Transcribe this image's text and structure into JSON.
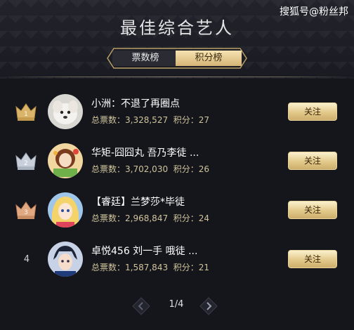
{
  "header": {
    "title": "最佳综合艺人",
    "watermark": "搜狐号@粉丝邦"
  },
  "tabs": [
    {
      "label": "票数榜",
      "active": false
    },
    {
      "label": "积分榜",
      "active": true
    }
  ],
  "colors": {
    "background": "#15161c",
    "gold": "#d8bd7e",
    "stats_text": "#d0c49c",
    "silver": "#b8c0cc",
    "bronze": "#d9a27a"
  },
  "list": [
    {
      "rank": "1",
      "rank_icon": "gold-crown-icon",
      "name": "小洲：不退了再圈点",
      "votes_label": "总票数：",
      "votes": "3,328,527",
      "points_label": "积分：",
      "points": "27",
      "follow": "关注"
    },
    {
      "rank": "2",
      "rank_icon": "silver-crown-icon",
      "name": "华矩-囧囧丸 吾乃李徒 ...",
      "votes_label": "总票数：",
      "votes": "3,702,030",
      "points_label": "积分：",
      "points": "26",
      "follow": "关注"
    },
    {
      "rank": "3",
      "rank_icon": "bronze-crown-icon",
      "name": "【睿廷】兰梦莎*毕徒",
      "votes_label": "总票数：",
      "votes": "2,968,847",
      "points_label": "积分：",
      "points": "24",
      "follow": "关注"
    },
    {
      "rank": "4",
      "rank_icon": "",
      "name": "卓悦456 刘一手 哦徒 ...",
      "votes_label": "总票数：",
      "votes": "1,587,843",
      "points_label": "积分：",
      "points": "21",
      "follow": "关注"
    }
  ],
  "pagination": {
    "label": "1/4"
  }
}
